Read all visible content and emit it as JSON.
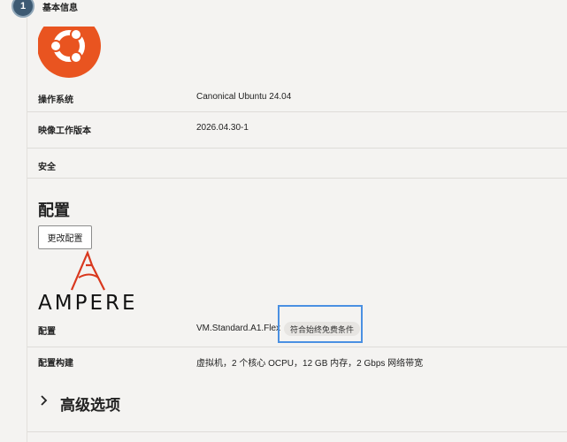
{
  "step": {
    "number": "1",
    "label": "基本信息"
  },
  "image_section": {
    "rows": [
      {
        "label": "操作系统",
        "value": "Canonical Ubuntu 24.04"
      },
      {
        "label": "映像工作版本",
        "value": "2026.04.30-1"
      },
      {
        "label": "安全",
        "value": ""
      }
    ],
    "logo": "ubuntu-logo",
    "logo_color": "#e95420"
  },
  "config_section": {
    "title": "配置",
    "edit_button": "更改配置",
    "vendor_logo_text": "AMPERE",
    "vendor_logo_color": "#d9381e",
    "rows": [
      {
        "label": "配置",
        "value": "VM.Standard.A1.Flex",
        "badge": "符合始终免费条件"
      },
      {
        "label": "配置构建",
        "value": "虚拟机，2 个核心 OCPU，12 GB 内存，2 Gbps 网络带宽"
      }
    ],
    "highlight_color": "#4a90e2"
  },
  "advanced": {
    "title": "高级选项",
    "icon": "chevron-right-icon"
  }
}
